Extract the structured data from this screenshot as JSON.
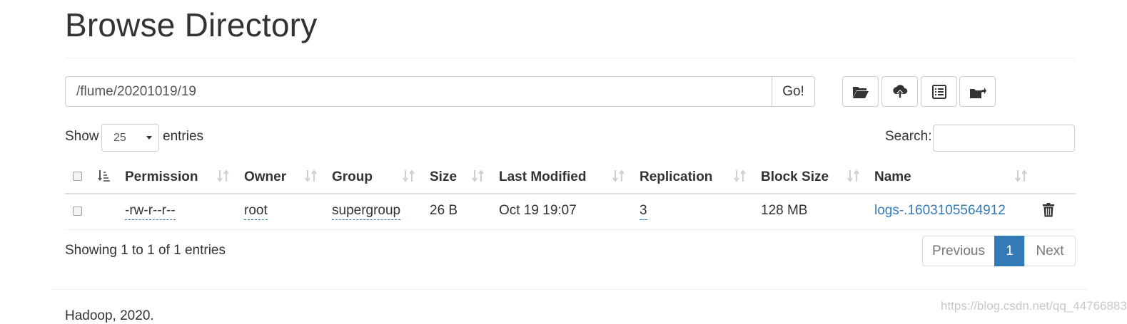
{
  "header": {
    "title": "Browse Directory"
  },
  "path_bar": {
    "value": "/flume/20201019/19",
    "go_label": "Go!"
  },
  "toolbar": {
    "icons": [
      "folder-open-icon",
      "cloud-upload-icon",
      "list-alt-icon",
      "folder-share-icon"
    ]
  },
  "table_controls": {
    "show_label": "Show",
    "page_length": "25",
    "entries_label": "entries",
    "search_label": "Search:",
    "search_value": ""
  },
  "table": {
    "columns": [
      "Permission",
      "Owner",
      "Group",
      "Size",
      "Last Modified",
      "Replication",
      "Block Size",
      "Name"
    ],
    "rows": [
      {
        "permission": "-rw-r--r--",
        "owner": "root",
        "group": "supergroup",
        "size": "26 B",
        "last_modified": "Oct 19 19:07",
        "replication": "3",
        "block_size": "128 MB",
        "name": "logs-.1603105564912"
      }
    ]
  },
  "table_info": "Showing 1 to 1 of 1 entries",
  "pagination": {
    "previous": "Previous",
    "current": "1",
    "next": "Next"
  },
  "footer": {
    "text": "Hadoop, 2020."
  },
  "watermark": "https://blog.csdn.net/qq_44766883",
  "colors": {
    "link": "#337ab7",
    "active_page": "#337ab7",
    "text": "#333333"
  }
}
